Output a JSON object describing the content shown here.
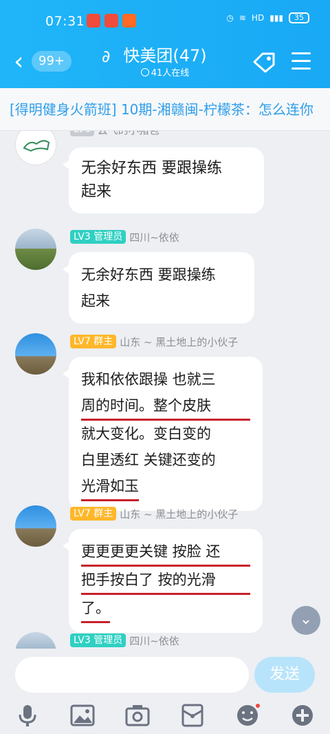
{
  "status_bar": {
    "time": "07:31",
    "battery": "35"
  },
  "header": {
    "badge": "99+",
    "title": "快美团(47)",
    "online": "41人在线"
  },
  "announcement": "[得明健身火箭班] 10期-湘赣闽-柠檬茶：怎么连你",
  "messages": [
    {
      "sender": "云飞的小猪包",
      "text": "无余好东西 要跟操练起来",
      "lines": [
        "无余好东西 要跟操练",
        "起来"
      ]
    },
    {
      "level": "LV3",
      "role": "管理员",
      "sender": "四川~依依",
      "lines": [
        "无余好东西 要跟操练",
        "起来"
      ]
    },
    {
      "level": "LV7",
      "role": "群主",
      "sender": "山东 ~ 黑土地上的小伙子",
      "lines": [
        "我和依依跟操 也就三",
        "周的时间。整个皮肤",
        "就大变化。变白变的",
        "白里透红 关键还变的",
        "光滑如玉"
      ]
    },
    {
      "level": "LV7",
      "role": "群主",
      "sender": "山东 ~ 黑土地上的小伙子",
      "lines": [
        "更更更更关键 按脸 还",
        "把手按白了 按的光滑",
        "了。"
      ]
    },
    {
      "level": "LV3",
      "role": "管理员",
      "sender": "四川~依依"
    }
  ],
  "input": {
    "send_label": "发送"
  },
  "icons": {
    "back": "chevron-left-icon",
    "ear": "ear-icon",
    "tag": "tag-icon",
    "menu": "menu-icon",
    "mic": "microphone-icon",
    "image": "image-icon",
    "camera": "camera-icon",
    "envelope": "red-packet-icon",
    "emoji": "emoji-icon",
    "plus": "plus-icon",
    "scroll": "chevron-down-icon"
  },
  "colors": {
    "accent": "#1aaaf5",
    "owner": "#ffb72a",
    "admin": "#2fd0c2",
    "underline": "#c8202a"
  }
}
